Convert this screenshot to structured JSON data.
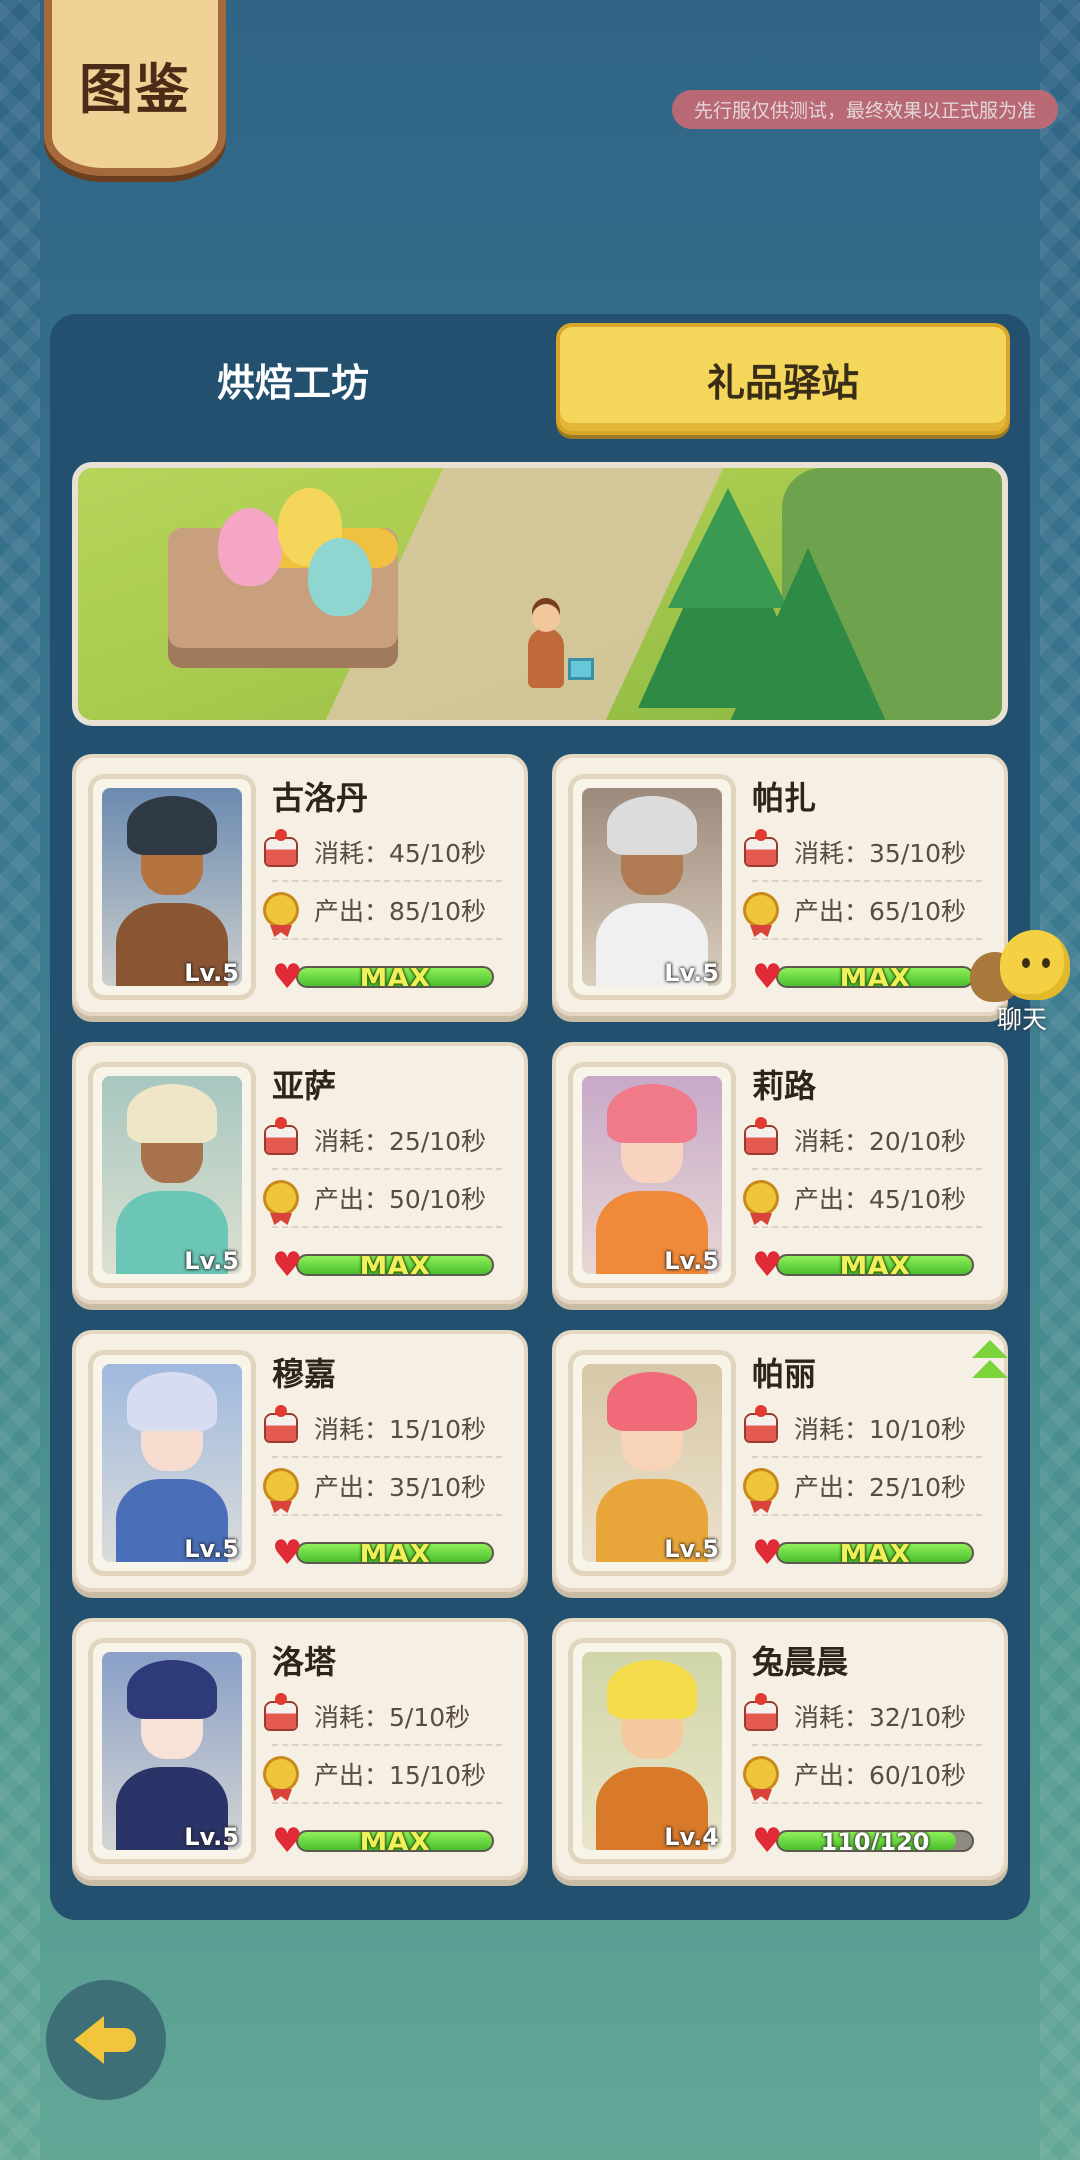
{
  "header": {
    "title": "图鉴",
    "notice": "先行服仅供测试，最终效果以正式服为准"
  },
  "tabs": [
    {
      "label": "烘焙工坊",
      "active": false
    },
    {
      "label": "礼品驿站",
      "active": true
    }
  ],
  "stat_labels": {
    "consume": "消耗：",
    "output": "产出："
  },
  "characters": [
    {
      "name": "古洛丹",
      "level": "Lv.5",
      "consume": "45/10秒",
      "output": "85/10秒",
      "bar_text": "MAX",
      "progress": 1.0,
      "upgradeable": false
    },
    {
      "name": "帕扎",
      "level": "Lv.5",
      "consume": "35/10秒",
      "output": "65/10秒",
      "bar_text": "MAX",
      "progress": 1.0,
      "upgradeable": false
    },
    {
      "name": "亚萨",
      "level": "Lv.5",
      "consume": "25/10秒",
      "output": "50/10秒",
      "bar_text": "MAX",
      "progress": 1.0,
      "upgradeable": false
    },
    {
      "name": "莉路",
      "level": "Lv.5",
      "consume": "20/10秒",
      "output": "45/10秒",
      "bar_text": "MAX",
      "progress": 1.0,
      "upgradeable": false
    },
    {
      "name": "穆嘉",
      "level": "Lv.5",
      "consume": "15/10秒",
      "output": "35/10秒",
      "bar_text": "MAX",
      "progress": 1.0,
      "upgradeable": false
    },
    {
      "name": "帕丽",
      "level": "Lv.5",
      "consume": "10/10秒",
      "output": "25/10秒",
      "bar_text": "MAX",
      "progress": 1.0,
      "upgradeable": true
    },
    {
      "name": "洛塔",
      "level": "Lv.5",
      "consume": "5/10秒",
      "output": "15/10秒",
      "bar_text": "MAX",
      "progress": 1.0,
      "upgradeable": false
    },
    {
      "name": "兔晨晨",
      "level": "Lv.4",
      "consume": "32/10秒",
      "output": "60/10秒",
      "bar_text": "110/120",
      "progress": 0.9167,
      "upgradeable": false
    }
  ],
  "chat": {
    "label": "聊天"
  },
  "colors": {
    "panel": "#22506e",
    "active_tab": "#f4d65a",
    "bar_fill": "#4ac02c",
    "heart": "#e02a36"
  }
}
